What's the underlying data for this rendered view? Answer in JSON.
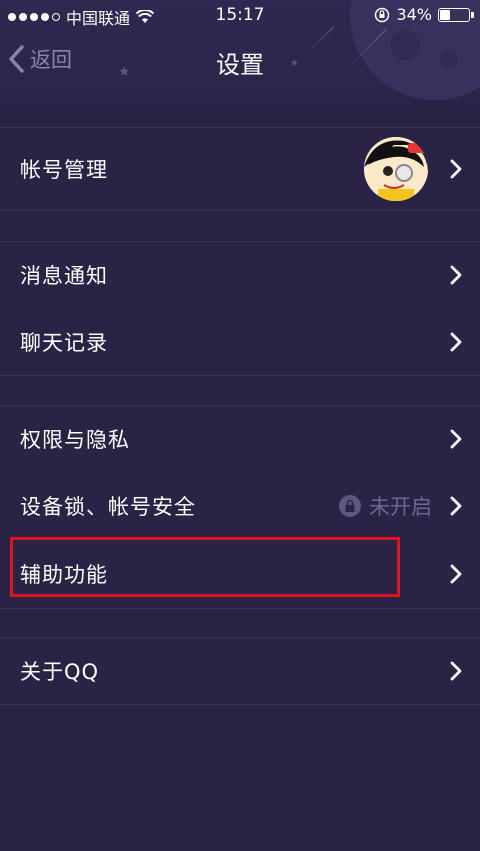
{
  "status_bar": {
    "carrier": "中国联通",
    "time": "15:17",
    "battery_percent": "34%",
    "battery_level": 0.34
  },
  "nav": {
    "back_label": "返回",
    "title": "设置"
  },
  "settings": {
    "account": {
      "label": "帐号管理"
    },
    "notifications": {
      "label": "消息通知"
    },
    "chat_history": {
      "label": "聊天记录"
    },
    "privacy": {
      "label": "权限与隐私"
    },
    "device_lock": {
      "label": "设备锁、帐号安全",
      "value": "未开启"
    },
    "accessibility": {
      "label": "辅助功能"
    },
    "about": {
      "label": "关于QQ"
    }
  },
  "colors": {
    "background": "#2a2346",
    "highlight": "#e0141c",
    "secondary_text": "#6e6890"
  }
}
